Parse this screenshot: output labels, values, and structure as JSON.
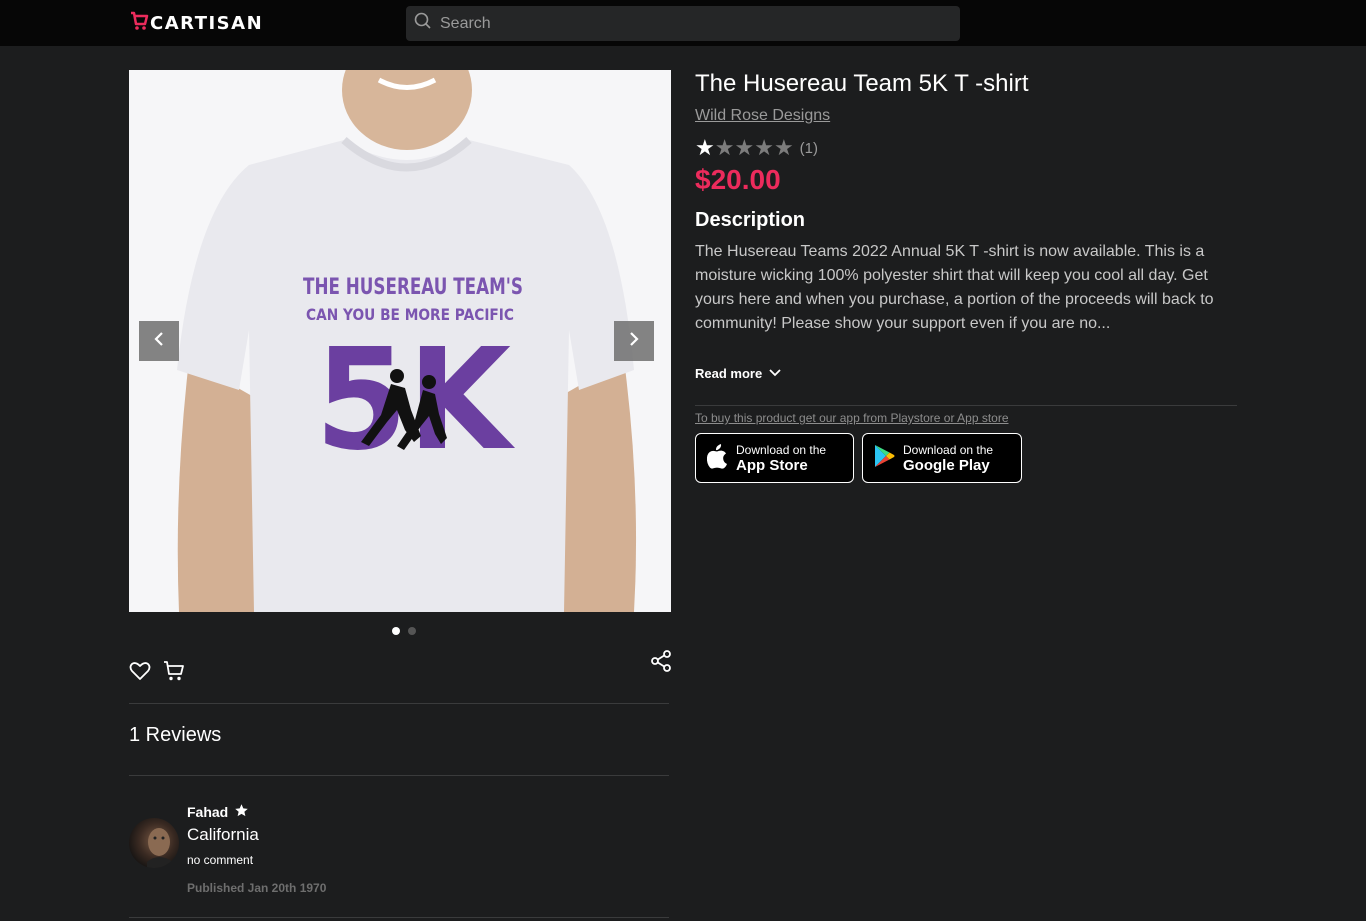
{
  "header": {
    "logo_text": "CARTISAN",
    "search_placeholder": "Search"
  },
  "product": {
    "title": "The Husereau Team 5K T -shirt",
    "seller": "Wild Rose Designs",
    "rating": 1,
    "rating_max": 5,
    "rating_count": "(1)",
    "price": "$20.00",
    "description_heading": "Description",
    "description": "The Husereau Teams 2022 Annual 5K T -shirt is now available. This is a moisture wicking 100% polyester shirt that will keep you cool all day. Get yours here and when you purchase, a portion of the proceeds will back to community! Please show your support even if you are no...",
    "read_more": "Read more",
    "app_note": "To buy this product get our app from Playstore or App store",
    "image": {
      "line1": "THE HUSEREAU TEAM'S",
      "line2": "CAN YOU BE MORE PACIFIC",
      "big": "5K"
    },
    "gallery": {
      "slides": 2,
      "active_slide": 1
    }
  },
  "stores": {
    "apple": {
      "small": "Download on the",
      "big": "App Store"
    },
    "google": {
      "small": "Download on the",
      "big": "Google Play"
    }
  },
  "reviews": {
    "heading": "1 Reviews",
    "items": [
      {
        "name": "Fahad",
        "location": "California",
        "comment": "no comment",
        "date": "Published Jan 20th 1970"
      }
    ]
  },
  "colors": {
    "background": "#1c1d1e",
    "topbar": "#060606",
    "accent": "#ec2b5c",
    "shirt_print": "#6b3fa0"
  }
}
